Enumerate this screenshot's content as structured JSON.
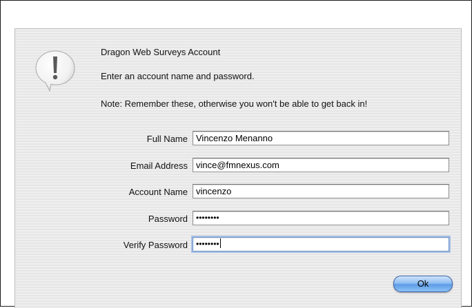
{
  "dialog": {
    "title": "Dragon Web Surveys Account",
    "subtitle": "Enter an account name and password.",
    "note": "Note: Remember these, otherwise you won't be able to get back in!"
  },
  "icon": "alert-exclamation-icon",
  "fields": [
    {
      "label": "Full Name",
      "value": "Vincenzo Menanno"
    },
    {
      "label": "Email Address",
      "value": "vince@fmnexus.com"
    },
    {
      "label": "Account Name",
      "value": "vincenzo"
    },
    {
      "label": "Password",
      "value": "••••••••"
    },
    {
      "label": "Verify Password",
      "value": "••••••••"
    }
  ],
  "buttons": {
    "ok_label": "Ok"
  },
  "colors": {
    "button_accent": "#5d9be6",
    "focus_ring": "#a7c1e6"
  }
}
